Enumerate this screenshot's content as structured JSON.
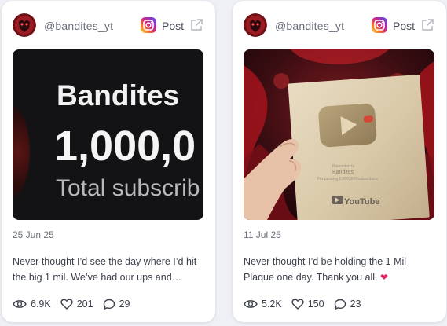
{
  "posts": [
    {
      "handle": "@bandites_yt",
      "platform_icon": "instagram-icon",
      "post_label": "Post",
      "external_icon": "external-link-icon",
      "media": {
        "title": "Bandites",
        "count": "1,000,0",
        "subtitle": "Total subscrib"
      },
      "date": "25 Jun 25",
      "caption": "Never thought I’d see the day where I’d hit the big 1 mil. We’ve had our ups and…",
      "views": "6.9K",
      "likes": "201",
      "comments": "29"
    },
    {
      "handle": "@bandites_yt",
      "platform_icon": "instagram-icon",
      "post_label": "Post",
      "external_icon": "external-link-icon",
      "media": {
        "plaque_presented": "Presented to",
        "plaque_name": "Bandites",
        "plaque_text": "For passing 1,000,000 subscribers",
        "plaque_brand": "YouTube"
      },
      "date": "11 Jul 25",
      "caption": "Never thought I’d be holding the 1 Mil Plaque one day. Thank you all.",
      "caption_emoji": "❤",
      "views": "5.2K",
      "likes": "150",
      "comments": "23"
    }
  ],
  "colors": {
    "accent_heart": "#e0245e",
    "brand_red": "#c8102e"
  }
}
